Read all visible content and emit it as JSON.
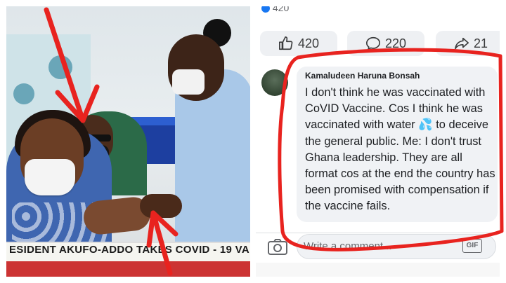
{
  "left_panel": {
    "ticker_text": "ESIDENT AKUFO-ADDO TAKES COVID - 19 VA"
  },
  "right_panel": {
    "top_count": "420",
    "likes": "420",
    "comments": "220",
    "shares": "21",
    "comment": {
      "author": "Kamaludeen Haruna Bonsah",
      "text_before_emoji": "I don't think he was vaccinated with CoVID Vaccine. Cos I think he was vaccinated with water ",
      "emoji": "💦",
      "text_after_emoji": " to deceive the general public. Me: I don't trust Ghana leadership. They are all format cos at the end the country has been promised with compensation if the vaccine fails."
    },
    "composer": {
      "placeholder": "Write a comment...",
      "gif_label": "GIF"
    }
  },
  "colors": {
    "annotation_red": "#e8231f",
    "fb_grey": "#f0f2f5",
    "text_dark": "#1c1e21"
  },
  "icons": [
    "thumbs-up-icon",
    "comment-icon",
    "share-icon",
    "camera-icon",
    "gif-icon"
  ]
}
